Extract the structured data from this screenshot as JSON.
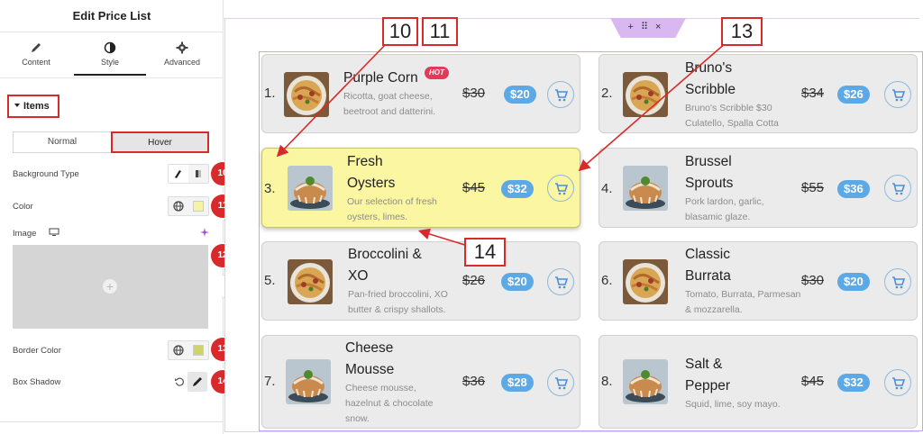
{
  "panel": {
    "title": "Edit Price List",
    "tabs": [
      {
        "label": "Content",
        "icon": "pencil-icon"
      },
      {
        "label": "Style",
        "icon": "half-circle-icon"
      },
      {
        "label": "Advanced",
        "icon": "gear-icon"
      }
    ],
    "section_label": "Items",
    "state_normal": "Normal",
    "state_hover": "Hover",
    "controls": {
      "background_type": "Background Type",
      "color": "Color",
      "image": "Image",
      "border_color": "Border Color",
      "box_shadow": "Box Shadow"
    },
    "badges": [
      "10",
      "11",
      "12",
      "13",
      "14"
    ],
    "hover_color": "#fbf6a1",
    "border_swatch": "#cfd46a"
  },
  "callouts": [
    "10",
    "11",
    "13",
    "14"
  ],
  "items": [
    {
      "num": "1.",
      "title": "Purple Corn",
      "desc": "Ricotta, goat cheese, beetroot and datterini.",
      "old": "$30",
      "new": "$20",
      "hot": "HOT",
      "img": "pasta"
    },
    {
      "num": "2.",
      "title": "Bruno's Scribble",
      "desc": "Bruno's Scribble $30 Culatello, Spalla Cotta",
      "old": "$34",
      "new": "$26",
      "img": "pasta"
    },
    {
      "num": "3.",
      "title": "Fresh Oysters",
      "desc": "Our selection of fresh oysters, limes.",
      "old": "$45",
      "new": "$32",
      "img": "cake",
      "highlighted": true
    },
    {
      "num": "4.",
      "title": "Brussel Sprouts",
      "desc": "Pork lardon, garlic, blasamic glaze.",
      "old": "$55",
      "new": "$36",
      "img": "cake"
    },
    {
      "num": "5.",
      "title": "Broccolini & XO",
      "desc": "Pan-fried broccolini, XO butter & crispy shallots.",
      "old": "$26",
      "new": "$20",
      "img": "pasta"
    },
    {
      "num": "6.",
      "title": "Classic Burrata",
      "desc": "Tomato, Burrata, Parmesan & mozzarella.",
      "old": "$30",
      "new": "$20",
      "img": "pasta"
    },
    {
      "num": "7.",
      "title": "Cheese Mousse",
      "desc": "Cheese mousse, hazelnut & chocolate snow.",
      "old": "$36",
      "new": "$28",
      "img": "cake"
    },
    {
      "num": "8.",
      "title": "Salt & Pepper",
      "desc": "Squid, lime, soy mayo.",
      "old": "$45",
      "new": "$32",
      "img": "cake"
    }
  ],
  "colors": {
    "accent_red": "#d82a2a",
    "price_badge": "#5ca9e6",
    "hot_badge": "#e23a58"
  }
}
